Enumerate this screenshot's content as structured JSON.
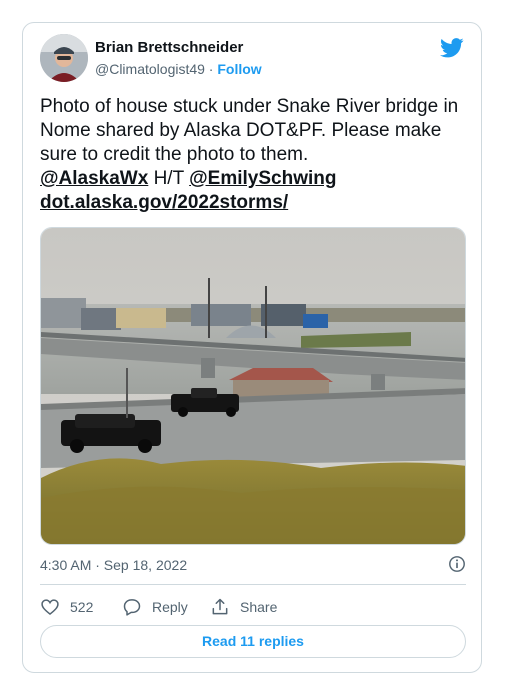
{
  "author": {
    "name": "Brian Brettschneider",
    "handle": "@Climatologist49",
    "separator": " · ",
    "follow_label": "Follow"
  },
  "tweet": {
    "text_line": "Photo of house stuck under Snake River bridge in Nome shared by Alaska DOT&PF. Please make sure to credit the photo to them.",
    "mention_1": "@AlaskaWx",
    "ht": " H/T ",
    "mention_2": "@EmilySchwing",
    "link": "dot.alaska.gov/2022storms/"
  },
  "meta": {
    "timestamp": "4:30 AM · Sep 18, 2022"
  },
  "actions": {
    "like_count": "522",
    "reply_label": "Reply",
    "share_label": "Share"
  },
  "read_replies_label": "Read 11 replies",
  "colors": {
    "accent": "#1d9bf0",
    "text": "#0f1419",
    "muted": "#536471",
    "border": "#cfd9de"
  },
  "icons": [
    "twitter-bird-icon",
    "info-icon",
    "heart-icon",
    "reply-icon",
    "share-icon"
  ]
}
